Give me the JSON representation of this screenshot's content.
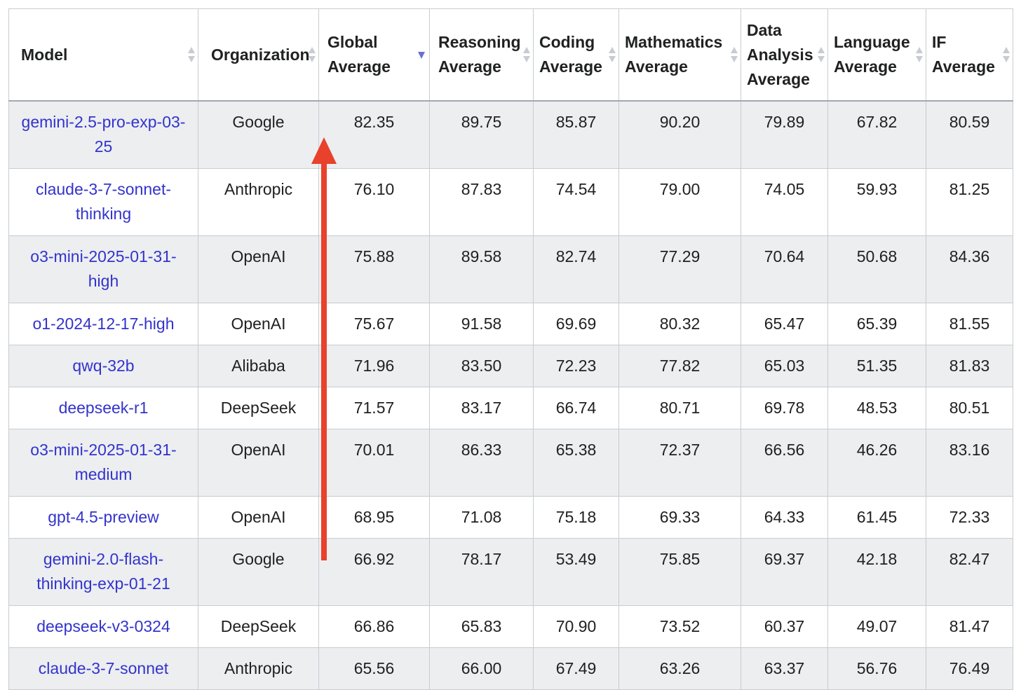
{
  "columns": [
    {
      "label": "Model",
      "sort": "none"
    },
    {
      "label": "Organization",
      "sort": "none"
    },
    {
      "label": "Global Average",
      "sort": "desc"
    },
    {
      "label": "Reasoning Average",
      "sort": "none"
    },
    {
      "label": "Coding Average",
      "sort": "none"
    },
    {
      "label": "Mathematics Average",
      "sort": "none"
    },
    {
      "label": "Data Analysis Average",
      "sort": "none"
    },
    {
      "label": "Language Average",
      "sort": "none"
    },
    {
      "label": "IF Average",
      "sort": "none"
    }
  ],
  "rows": [
    {
      "model": "gemini-2.5-pro-exp-03-25",
      "org": "Google",
      "global": "82.35",
      "reasoning": "89.75",
      "coding": "85.87",
      "math": "90.20",
      "data": "79.89",
      "language": "67.82",
      "if": "80.59"
    },
    {
      "model": "claude-3-7-sonnet-thinking",
      "org": "Anthropic",
      "global": "76.10",
      "reasoning": "87.83",
      "coding": "74.54",
      "math": "79.00",
      "data": "74.05",
      "language": "59.93",
      "if": "81.25"
    },
    {
      "model": "o3-mini-2025-01-31-high",
      "org": "OpenAI",
      "global": "75.88",
      "reasoning": "89.58",
      "coding": "82.74",
      "math": "77.29",
      "data": "70.64",
      "language": "50.68",
      "if": "84.36"
    },
    {
      "model": "o1-2024-12-17-high",
      "org": "OpenAI",
      "global": "75.67",
      "reasoning": "91.58",
      "coding": "69.69",
      "math": "80.32",
      "data": "65.47",
      "language": "65.39",
      "if": "81.55"
    },
    {
      "model": "qwq-32b",
      "org": "Alibaba",
      "global": "71.96",
      "reasoning": "83.50",
      "coding": "72.23",
      "math": "77.82",
      "data": "65.03",
      "language": "51.35",
      "if": "81.83"
    },
    {
      "model": "deepseek-r1",
      "org": "DeepSeek",
      "global": "71.57",
      "reasoning": "83.17",
      "coding": "66.74",
      "math": "80.71",
      "data": "69.78",
      "language": "48.53",
      "if": "80.51"
    },
    {
      "model": "o3-mini-2025-01-31-medium",
      "org": "OpenAI",
      "global": "70.01",
      "reasoning": "86.33",
      "coding": "65.38",
      "math": "72.37",
      "data": "66.56",
      "language": "46.26",
      "if": "83.16"
    },
    {
      "model": "gpt-4.5-preview",
      "org": "OpenAI",
      "global": "68.95",
      "reasoning": "71.08",
      "coding": "75.18",
      "math": "69.33",
      "data": "64.33",
      "language": "61.45",
      "if": "72.33"
    },
    {
      "model": "gemini-2.0-flash-thinking-exp-01-21",
      "org": "Google",
      "global": "66.92",
      "reasoning": "78.17",
      "coding": "53.49",
      "math": "75.85",
      "data": "69.37",
      "language": "42.18",
      "if": "82.47"
    },
    {
      "model": "deepseek-v3-0324",
      "org": "DeepSeek",
      "global": "66.86",
      "reasoning": "65.83",
      "coding": "70.90",
      "math": "73.52",
      "data": "60.37",
      "language": "49.07",
      "if": "81.47"
    },
    {
      "model": "claude-3-7-sonnet",
      "org": "Anthropic",
      "global": "65.56",
      "reasoning": "66.00",
      "coding": "67.49",
      "math": "63.26",
      "data": "63.37",
      "language": "56.76",
      "if": "76.49"
    }
  ],
  "colors": {
    "link": "#3333cc",
    "arrow": "#e8412c",
    "stripe": "#eceef0",
    "border": "#c8ccd1"
  },
  "annotation": {
    "type": "arrow-up",
    "color": "#e8412c"
  }
}
